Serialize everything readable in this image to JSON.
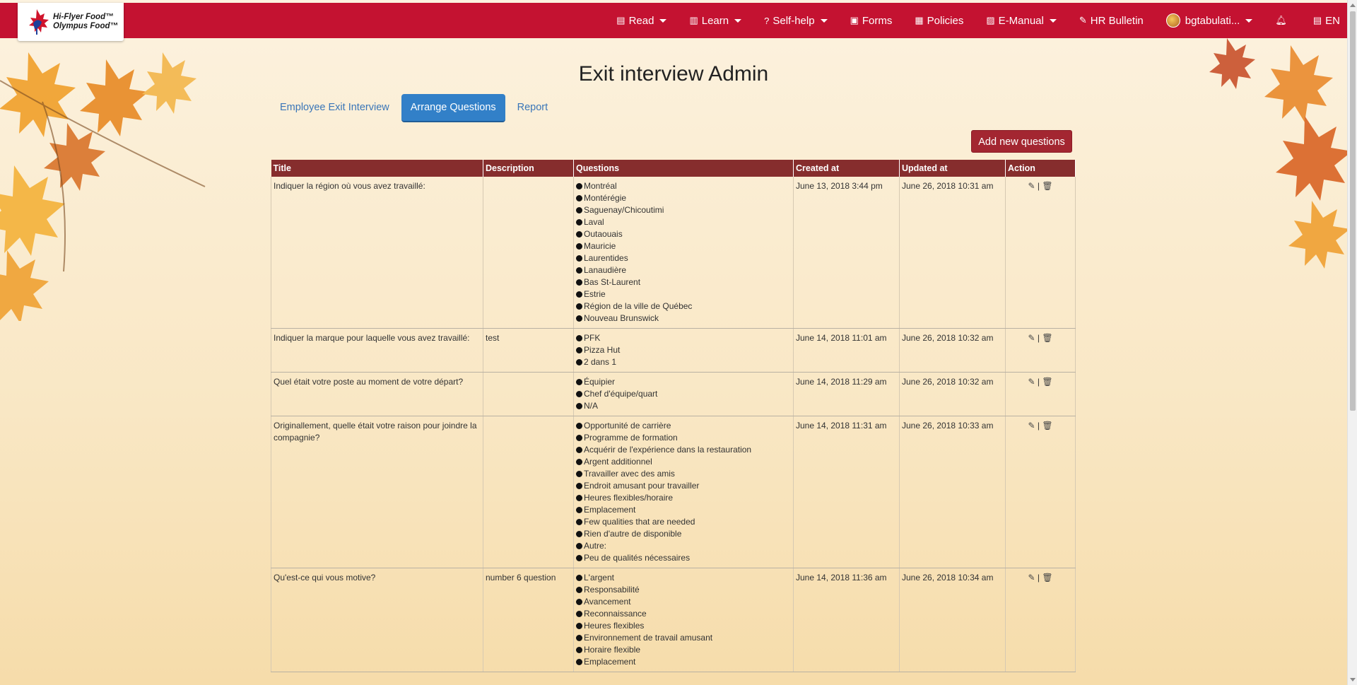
{
  "brand": {
    "logo_line1": "Hi-Flyer Food™",
    "logo_line2": "Olympus Food™"
  },
  "nav": {
    "read": "Read",
    "learn": "Learn",
    "self_help": "Self-help",
    "forms": "Forms",
    "policies": "Policies",
    "e_manual": "E-Manual",
    "hr_bulletin": "HR Bulletin",
    "user": "bgtabulati...",
    "lang": "EN"
  },
  "page": {
    "title": "Exit interview Admin",
    "tabs": [
      {
        "label": "Employee Exit Interview"
      },
      {
        "label": "Arrange Questions"
      },
      {
        "label": "Report"
      }
    ],
    "add_button": "Add new questions"
  },
  "table": {
    "headers": [
      "Title",
      "Description",
      "Questions",
      "Created at",
      "Updated at",
      "Action"
    ],
    "action_separator": "|",
    "rows": [
      {
        "title": "Indiquer la région où vous avez travaillé:",
        "description": "",
        "options": [
          "Montréal",
          "Montérégie",
          "Saguenay/Chicoutimi",
          "Laval",
          "Outaouais",
          "Mauricie",
          "Laurentides",
          "Lanaudière",
          "Bas St-Laurent",
          "Estrie",
          "Région de la ville de Québec",
          "Nouveau Brunswick"
        ],
        "created": "June 13, 2018 3:44 pm",
        "updated": "June 26, 2018 10:31 am"
      },
      {
        "title": "Indiquer la marque pour laquelle vous avez travaillé:",
        "description": "test",
        "options": [
          "PFK",
          "Pizza Hut",
          "2 dans 1"
        ],
        "created": "June 14, 2018 11:01 am",
        "updated": "June 26, 2018 10:32 am"
      },
      {
        "title": "Quel était votre poste au moment de votre départ?",
        "description": "",
        "options": [
          "Équipier",
          "Chef d'équipe/quart",
          "N/A"
        ],
        "created": "June 14, 2018 11:29 am",
        "updated": "June 26, 2018 10:32 am"
      },
      {
        "title": "Originallement, quelle était votre raison pour joindre la compagnie?",
        "description": "",
        "options": [
          "Opportunité de carrière",
          "Programme de formation",
          "Acquérir de l'expérience dans la restauration",
          "Argent additionnel",
          "Travailler avec des amis",
          "Endroit amusant pour travailler",
          "Heures flexibles/horaire",
          "Emplacement",
          "Few qualities that are needed",
          "Rien d'autre de disponible",
          "Autre:",
          "Peu de qualités nécessaires"
        ],
        "created": "June 14, 2018 11:31 am",
        "updated": "June 26, 2018 10:33 am"
      },
      {
        "title": "Qu'est-ce qui vous motive?",
        "description": "number 6 question",
        "options": [
          "L'argent",
          "Responsabilité",
          "Avancement",
          "Reconnaissance",
          "Heures flexibles",
          "Environnement de travail amusant",
          "Horaire flexible",
          "Emplacement"
        ],
        "created": "June 14, 2018 11:36 am",
        "updated": "June 26, 2018 10:34 am"
      }
    ]
  },
  "colors": {
    "navbar": "#c41231",
    "table_header": "#862d2d",
    "active_tab": "#3280c8",
    "add_button": "#a32631"
  }
}
